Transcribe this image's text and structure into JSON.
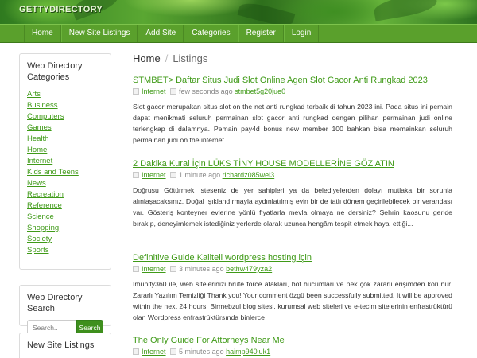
{
  "header": {
    "logo_text": "GETTYDIRECTORY"
  },
  "nav": {
    "items": [
      {
        "label": "Home"
      },
      {
        "label": "New Site Listings"
      },
      {
        "label": "Add Site"
      },
      {
        "label": "Categories"
      },
      {
        "label": "Register"
      },
      {
        "label": "Login"
      }
    ]
  },
  "sidebar": {
    "categories_title": "Web Directory Categories",
    "categories": [
      "Arts",
      "Business",
      "Computers",
      "Games",
      "Health",
      "Home",
      "Internet",
      "Kids and Teens",
      "News",
      "Recreation",
      "Reference",
      "Science",
      "Shopping",
      "Society",
      "Sports"
    ],
    "search_title": "Web Directory Search",
    "search_placeholder": "Search..",
    "search_button": "Search",
    "new_listings_title": "New Site Listings"
  },
  "breadcrumb": {
    "home": "Home",
    "separator": "/",
    "current": "Listings"
  },
  "listings": [
    {
      "title": "STMBET> Daftar Situs Judi Slot Online Agen Slot Gacor Anti Rungkad 2023",
      "category": "Internet",
      "time": "few seconds ago",
      "user": "stmbet5g20jue0",
      "description": "Slot gacor merupakan situs slot on the net anti rungkad terbaik di tahun 2023 ini. Pada situs ini pemain dapat menikmati seluruh permainan slot gacor anti rungkad dengan pilihan permainan judi online terlengkap di dalamnya. Pemain pay4d bonus new member 100 bahkan bisa memainkan seluruh permainan judi on the internet"
    },
    {
      "title": "2 Dakika Kural İçin LÜKS TİNY HOUSE MODELLERİNE GÖZ ATIN",
      "category": "Internet",
      "time": "1 minute ago",
      "user": "richardz085wel3",
      "description": "Doğrusu Götürmek isteseniz de yer sahipleri ya da belediyelerden dolayı mutlaka bir sorunla alınlaşacaksınız. Doğal ışıklandırmayla aydınlatılmış evin bir de tatlı dönem geçirilebilecek bir verandası var. Gösteriş konteyner evlerine yönlü fiyatlarla mevla olmaya ne dersiniz? Şehrin kaosunu geride bırakıp, deneyimlemek istediğiniz yerlerde olarak uzunca hengâm tespit etmek hayal ettiği..."
    },
    {
      "title": "Definitive Guide Kaliteli wordpress hosting için",
      "category": "Internet",
      "time": "3 minutes ago",
      "user": "bethw479yza2",
      "description": "Imunify360 ile, web sitelerinizi brute force atakları, bot hücumları ve pek çok zararlı erişimden korunur. Zararlı Yazılım Temizliği Thank you! Your comment özgü been successfully submitted. It will be approved within the next 24 hours. Birmebzul blog sitesi, kurumsal web siteleri ve e-tecim sitelerinin enfrastrüktürü olan Wordpress enfrastrüktürsında binlerce"
    },
    {
      "title": "The Only Guide For Attorneys Near Me",
      "category": "Internet",
      "time": "5 minutes ago",
      "user": "haimp940iuk1",
      "description": ""
    }
  ]
}
